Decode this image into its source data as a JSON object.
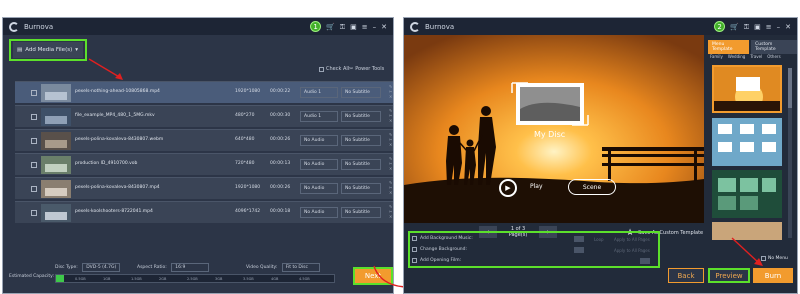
{
  "left": {
    "app_title": "Burnova",
    "step": "1",
    "add_media_label": "Add Media File(s)",
    "check_all": "Check All",
    "power_tools": "Power Tools",
    "files": [
      {
        "name": "pexels-nothing-ahead-10805868.mp4",
        "res": "1920*1080",
        "dur": "00:00:22",
        "audio": "Audio 1",
        "sub": "No Subtitle"
      },
      {
        "name": "file_example_MP4_480_1_5MG.mkv",
        "res": "480*270",
        "dur": "00:00:30",
        "audio": "Audio 1",
        "sub": "No Subtitle"
      },
      {
        "name": "pexels-polina-kovaleva-8430807.webm",
        "res": "640*480",
        "dur": "00:00:26",
        "audio": "No Audio",
        "sub": "No Subtitle"
      },
      {
        "name": "production ID_4910700.vob",
        "res": "720*480",
        "dur": "00:00:13",
        "audio": "No Audio",
        "sub": "No Subtitle"
      },
      {
        "name": "pexels-polina-kovaleva-8430807.mp4",
        "res": "1920*1080",
        "dur": "00:00:26",
        "audio": "No Audio",
        "sub": "No Subtitle"
      },
      {
        "name": "pexels-koolshooters-8722041.mp4",
        "res": "4096*1742",
        "dur": "00:00:18",
        "audio": "No Audio",
        "sub": "No Subtitle"
      }
    ],
    "disc_type_label": "Disc Type:",
    "disc_type_value": "DVD-5 (4.7G)",
    "aspect_ratio_label": "Aspect Ratio:",
    "aspect_ratio_value": "16:9",
    "video_quality_label": "Video Quality:",
    "video_quality_value": "Fit to Disc",
    "capacity_label": "Estimated Capacity:",
    "capacity_fill": 0.03,
    "ticks": [
      "0.5GB",
      "1GB",
      "1.5GB",
      "2GB",
      "2.5GB",
      "3GB",
      "3.5GB",
      "4GB",
      "4.5GB"
    ],
    "next_label": "Next"
  },
  "right": {
    "app_title": "Burnova",
    "step": "2",
    "menu_title": "My Disc",
    "play_label": "Play",
    "scene_label": "Scene",
    "page_text": "1 of 3 Page(s)",
    "save_template": "Save As Custom Template",
    "tabs": [
      "Menu Template",
      "Custom Template"
    ],
    "categories": [
      "Family",
      "Wedding",
      "Travel",
      "Others"
    ],
    "options": [
      "Add Background Music:",
      "Change Background:",
      "Add Opening Film:"
    ],
    "option_side_labels": [
      "Loop",
      "Apply to All Pages",
      "Apply to All Pages"
    ],
    "no_menu": "No Menu",
    "back_label": "Back",
    "preview_label": "Preview",
    "burn_label": "Burn"
  }
}
